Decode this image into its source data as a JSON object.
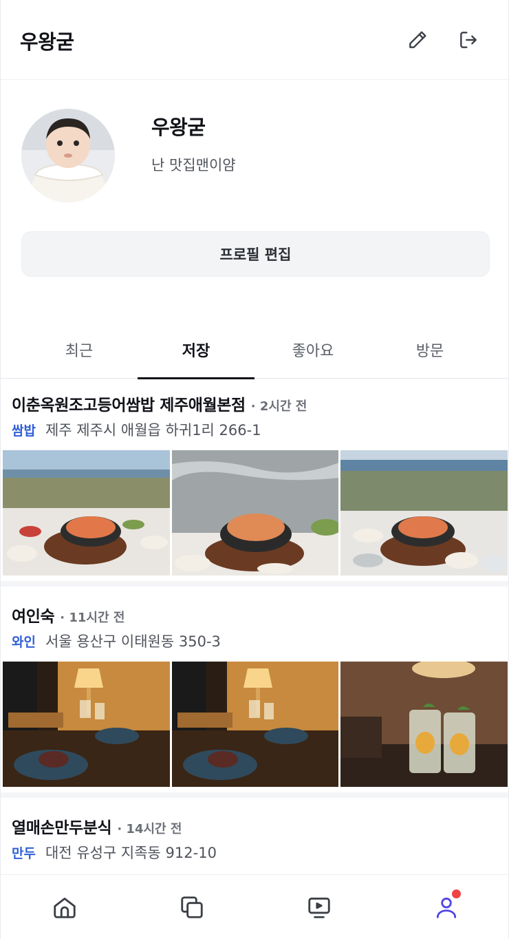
{
  "header": {
    "title": "우왕굳",
    "edit_icon": "pencil-icon",
    "logout_icon": "logout-icon"
  },
  "profile": {
    "name": "우왕굳",
    "bio": "난 맛집맨이얌",
    "edit_button_label": "프로필 편집"
  },
  "tabs": [
    {
      "label": "최근",
      "active": false
    },
    {
      "label": "저장",
      "active": true
    },
    {
      "label": "좋아요",
      "active": false
    },
    {
      "label": "방문",
      "active": false
    }
  ],
  "posts": [
    {
      "name": "이춘옥원조고등어쌈밥 제주애월본점",
      "time": "· 2시간 전",
      "category": "쌈밥",
      "address": "제주 제주시 애월읍 하귀1리 266-1"
    },
    {
      "name": "여인숙",
      "time": "· 11시간 전",
      "category": "와인",
      "address": "서울 용산구 이태원동 350-3"
    },
    {
      "name": "열매손만두분식",
      "time": "· 14시간 전",
      "category": "만두",
      "address": "대전 유성구 지족동 912-10"
    }
  ],
  "bottom_nav": [
    {
      "icon": "home-icon",
      "active": false
    },
    {
      "icon": "copy-icon",
      "active": false
    },
    {
      "icon": "video-icon",
      "active": false
    },
    {
      "icon": "profile-icon",
      "active": true,
      "badge": true
    }
  ],
  "colors": {
    "accent": "#4f46e5",
    "category": "#2f5fd8",
    "badge": "#ef4444"
  }
}
